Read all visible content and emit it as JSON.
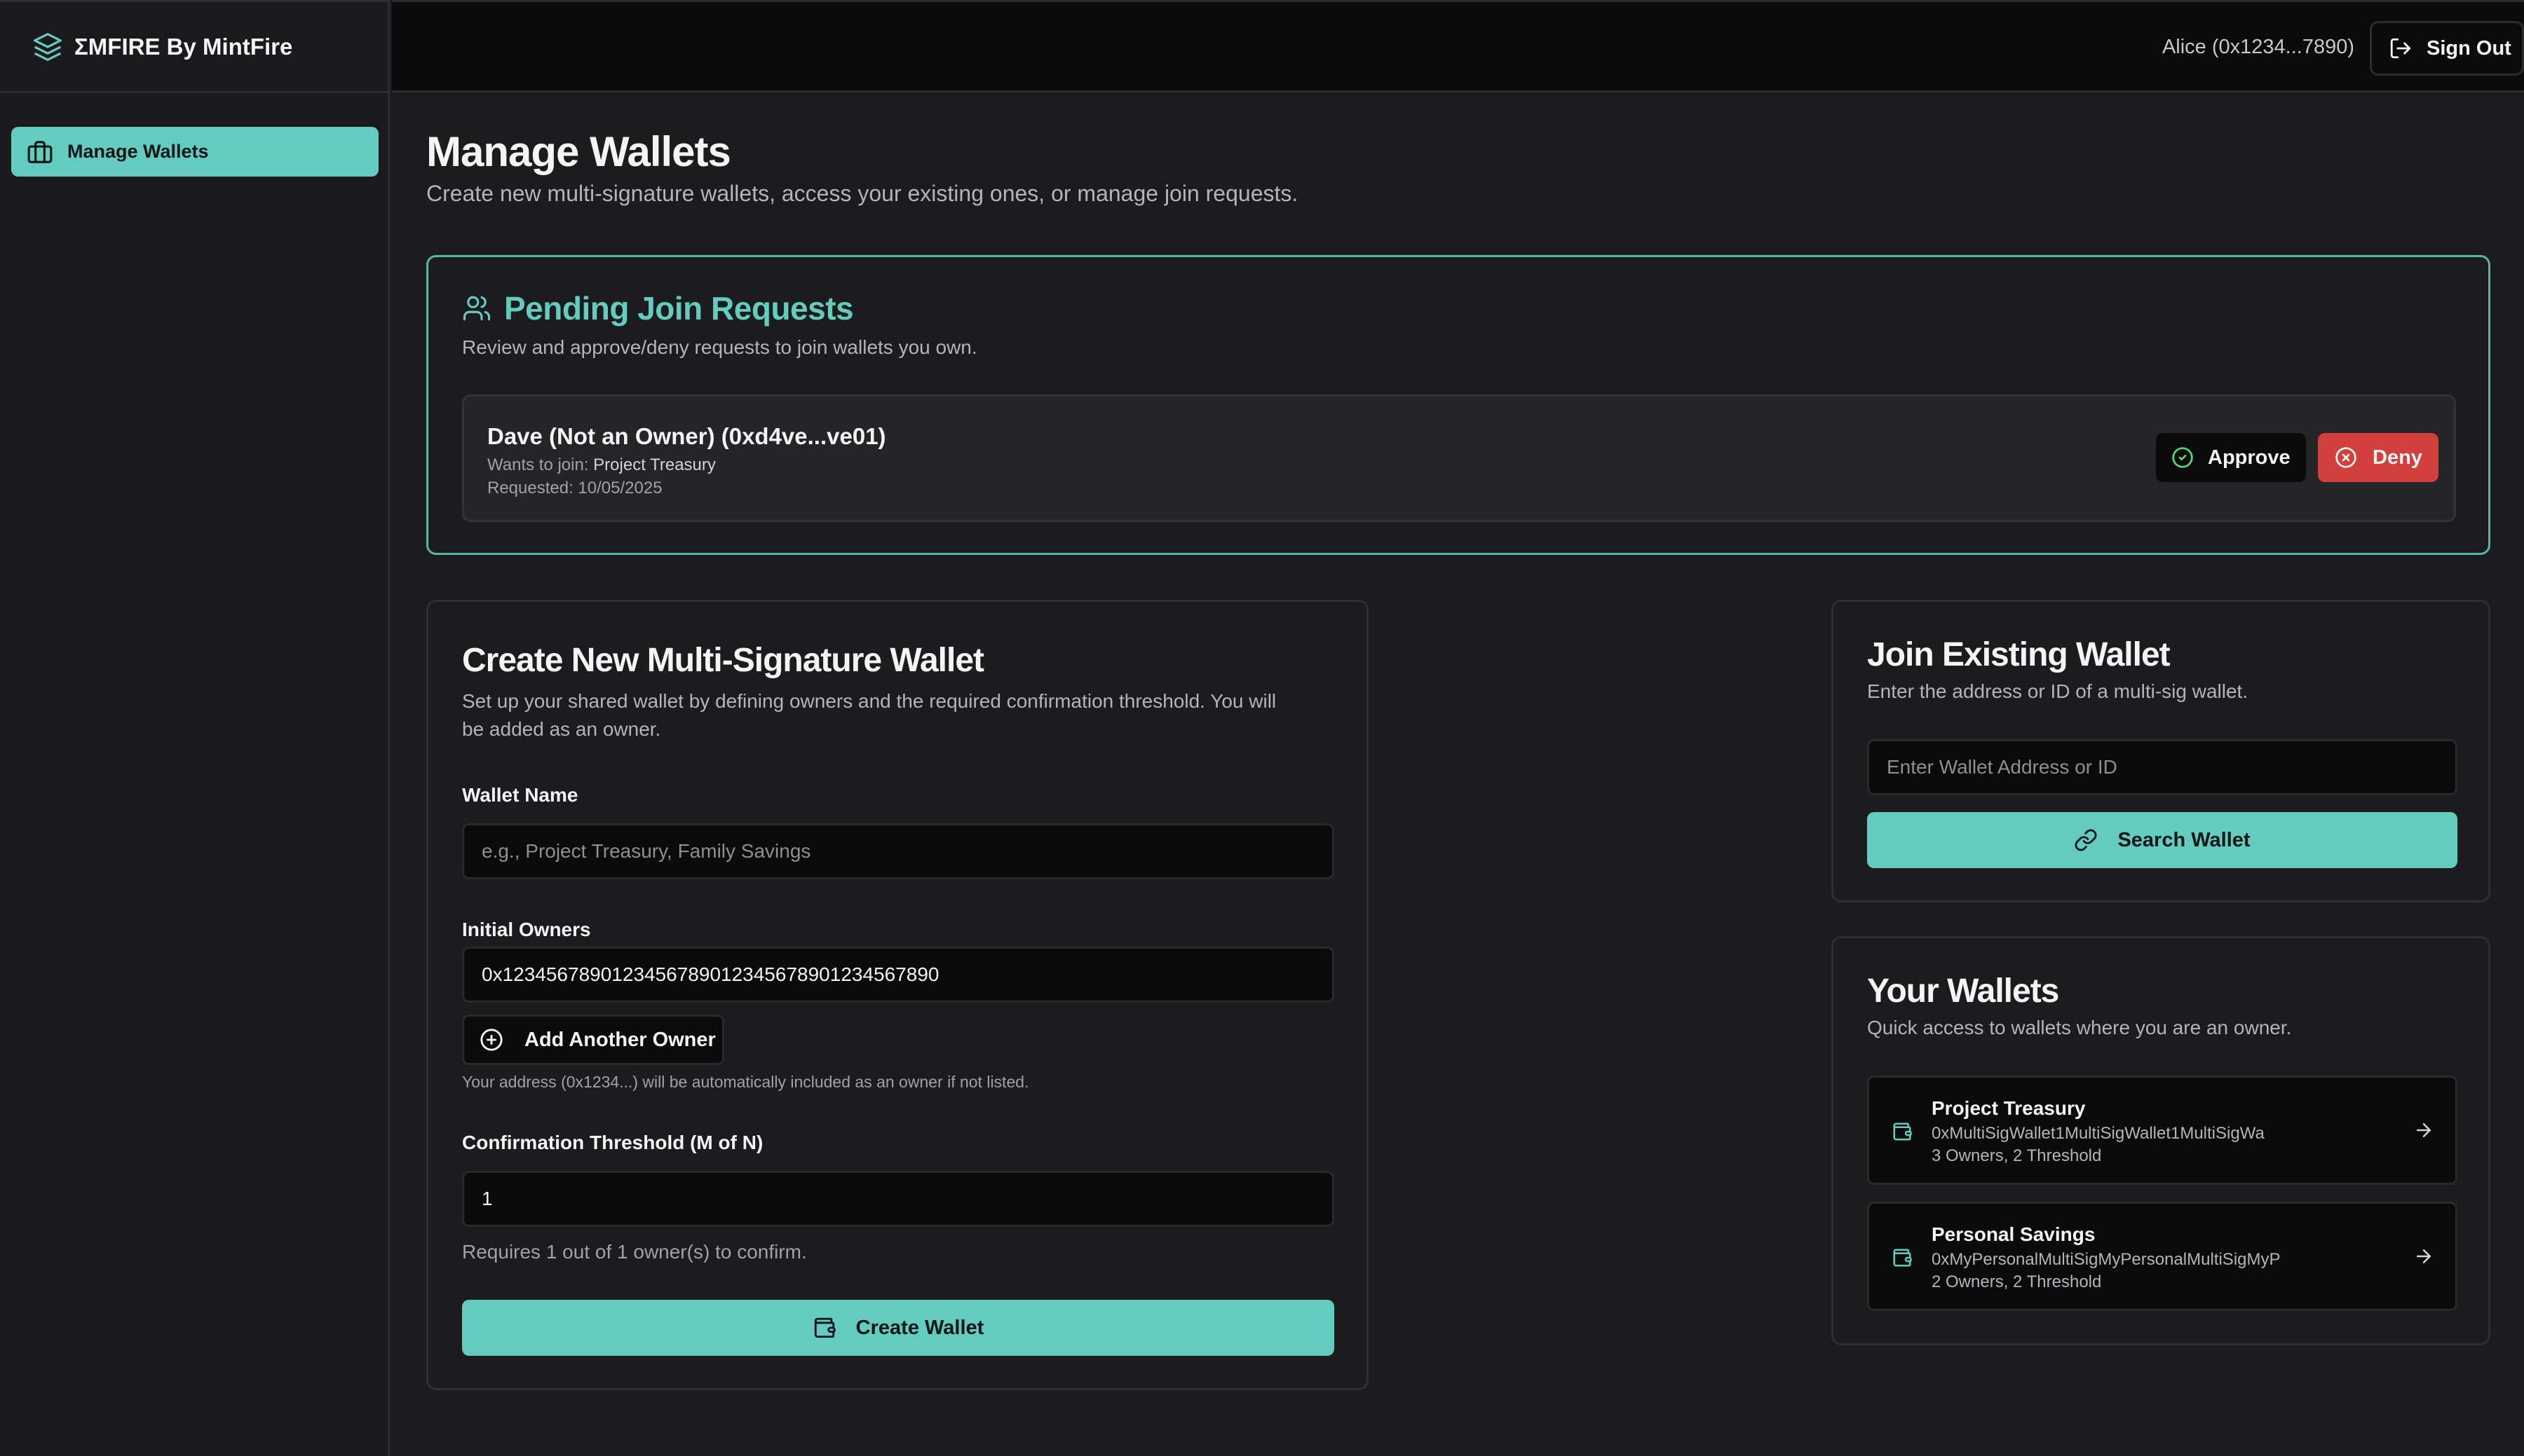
{
  "brand": {
    "title": "ΣMFIRE By MintFire",
    "icon": "layers-icon"
  },
  "sidebar": {
    "items": [
      {
        "label": "Manage Wallets",
        "icon": "briefcase-icon",
        "active": true
      }
    ]
  },
  "topbar": {
    "user": "Alice (0x1234...7890)",
    "signout_label": "Sign Out",
    "theme_icon": "sun-icon"
  },
  "page": {
    "title": "Manage Wallets",
    "subtitle": "Create new multi-signature wallets, access your existing ones, or manage join requests."
  },
  "pending": {
    "title": "Pending Join Requests",
    "subtitle": "Review and approve/deny requests to join wallets you own.",
    "requests": [
      {
        "name": "Dave (Not an Owner) (0xd4ve...ve01)",
        "wants_prefix": "Wants to join: ",
        "wallet": "Project Treasury",
        "requested": "Requested: 10/05/2025",
        "approve_label": "Approve",
        "deny_label": "Deny"
      }
    ]
  },
  "create": {
    "title": "Create New Multi-Signature Wallet",
    "subtitle_line1": "Set up your shared wallet by defining owners and the required confirmation threshold. You will",
    "subtitle_line2": "be added as an owner.",
    "wallet_name_label": "Wallet Name",
    "wallet_name_placeholder": "e.g., Project Treasury, Family Savings",
    "owners_label": "Initial Owners",
    "owners_value": "0x1234567890123456789012345678901234567890",
    "add_owner_label": "Add Another Owner",
    "owner_hint": "Your address (0x1234...) will be automatically included as an owner if not listed.",
    "threshold_label": "Confirmation Threshold (M of N)",
    "threshold_value": "1",
    "threshold_hint": "Requires 1 out of 1 owner(s) to confirm.",
    "create_label": "Create Wallet"
  },
  "join": {
    "title": "Join Existing Wallet",
    "subtitle": "Enter the address or ID of a multi-sig wallet.",
    "input_placeholder": "Enter Wallet Address or ID",
    "search_label": "Search Wallet"
  },
  "wallets": {
    "title": "Your Wallets",
    "subtitle": "Quick access to wallets where you are an owner.",
    "items": [
      {
        "name": "Project Treasury",
        "address": "0xMultiSigWallet1MultiSigWallet1MultiSigWa",
        "meta": "3 Owners, 2 Threshold"
      },
      {
        "name": "Personal Savings",
        "address": "0xMyPersonalMultiSigMyPersonalMultiSigMyP",
        "meta": "2 Owners, 2 Threshold"
      }
    ]
  },
  "colors": {
    "accent": "#63cbbf",
    "danger": "#d33f3c",
    "background": "#1c1c1e",
    "topbar": "#0b0b0c"
  }
}
